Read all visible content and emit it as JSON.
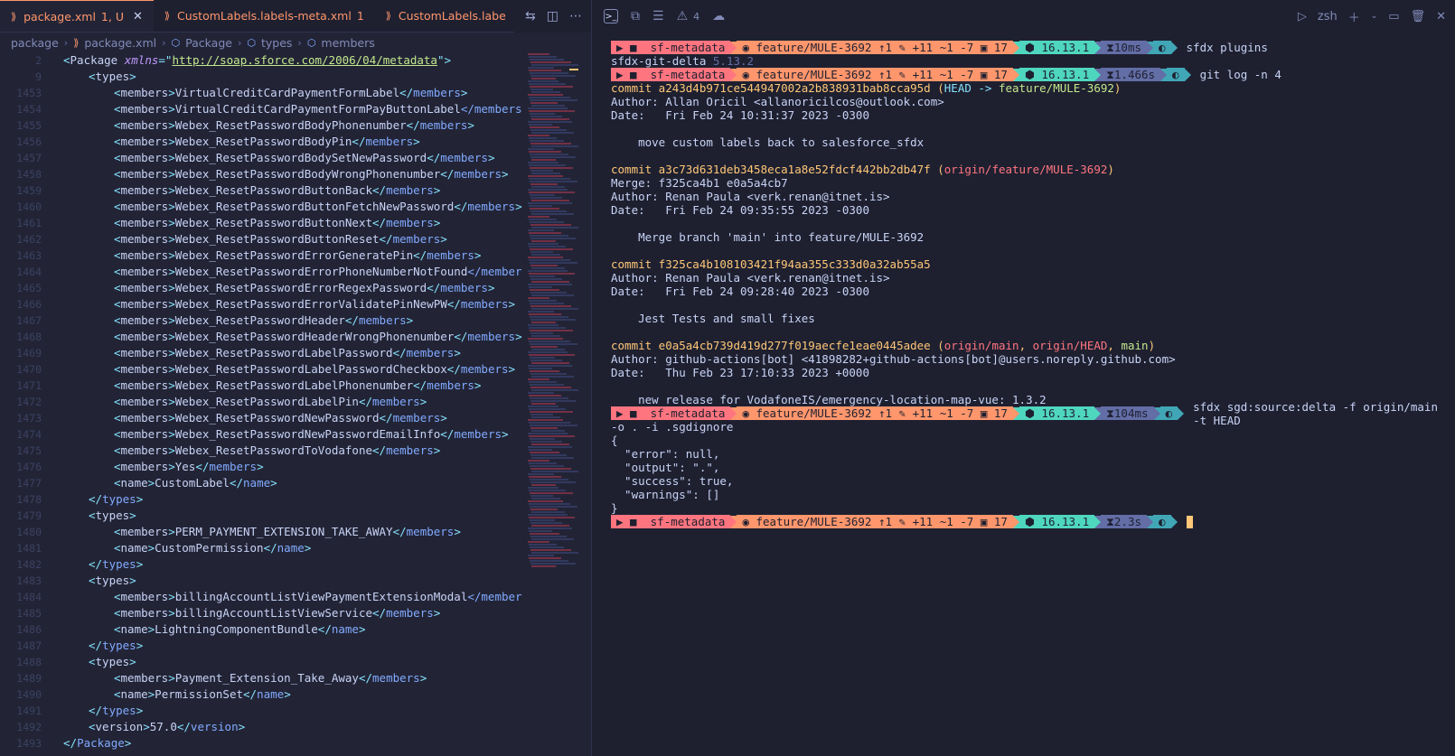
{
  "editor": {
    "tabs": [
      {
        "label": "package.xml",
        "status": "1, U",
        "active": true
      },
      {
        "label": "CustomLabels.labels-meta.xml",
        "status": "1",
        "active": false
      },
      {
        "label": "CustomLabels.labe",
        "status": "",
        "active": false
      }
    ],
    "breadcrumb": [
      "package",
      "package.xml",
      "Package",
      "types",
      "members"
    ],
    "lines": [
      {
        "n": "2",
        "indent": 0,
        "kind": "package-open",
        "text": "Package",
        "attr": "xmlns",
        "url": "http://soap.sforce.com/2006/04/metadata"
      },
      {
        "n": "9",
        "indent": 1,
        "kind": "open",
        "tag": "types"
      },
      {
        "n": "1453",
        "indent": 2,
        "kind": "el",
        "tag": "members",
        "value": "VirtualCreditCardPaymentFormLabel"
      },
      {
        "n": "1454",
        "indent": 2,
        "kind": "el",
        "tag": "members",
        "value": "VirtualCreditCardPaymentFormPayButtonLabel",
        "closeTrunc": "</members"
      },
      {
        "n": "1455",
        "indent": 2,
        "kind": "el",
        "tag": "members",
        "value": "Webex_ResetPasswordBodyPhonenumber"
      },
      {
        "n": "1456",
        "indent": 2,
        "kind": "el",
        "tag": "members",
        "value": "Webex_ResetPasswordBodyPin"
      },
      {
        "n": "1457",
        "indent": 2,
        "kind": "el",
        "tag": "members",
        "value": "Webex_ResetPasswordBodySetNewPassword"
      },
      {
        "n": "1458",
        "indent": 2,
        "kind": "el",
        "tag": "members",
        "value": "Webex_ResetPasswordBodyWrongPhonenumber"
      },
      {
        "n": "1459",
        "indent": 2,
        "kind": "el",
        "tag": "members",
        "value": "Webex_ResetPasswordButtonBack"
      },
      {
        "n": "1460",
        "indent": 2,
        "kind": "el",
        "tag": "members",
        "value": "Webex_ResetPasswordButtonFetchNewPassword"
      },
      {
        "n": "1461",
        "indent": 2,
        "kind": "el",
        "tag": "members",
        "value": "Webex_ResetPasswordButtonNext"
      },
      {
        "n": "1462",
        "indent": 2,
        "kind": "el",
        "tag": "members",
        "value": "Webex_ResetPasswordButtonReset"
      },
      {
        "n": "1463",
        "indent": 2,
        "kind": "el",
        "tag": "members",
        "value": "Webex_ResetPasswordErrorGeneratePin"
      },
      {
        "n": "1464",
        "indent": 2,
        "kind": "el",
        "tag": "members",
        "value": "Webex_ResetPasswordErrorPhoneNumberNotFound",
        "closeTrunc": "</member"
      },
      {
        "n": "1465",
        "indent": 2,
        "kind": "el",
        "tag": "members",
        "value": "Webex_ResetPasswordErrorRegexPassword"
      },
      {
        "n": "1466",
        "indent": 2,
        "kind": "el",
        "tag": "members",
        "value": "Webex_ResetPasswordErrorValidatePinNewPW"
      },
      {
        "n": "1467",
        "indent": 2,
        "kind": "el",
        "tag": "members",
        "value": "Webex_ResetPasswordHeader"
      },
      {
        "n": "1468",
        "indent": 2,
        "kind": "el",
        "tag": "members",
        "value": "Webex_ResetPasswordHeaderWrongPhonenumber"
      },
      {
        "n": "1469",
        "indent": 2,
        "kind": "el",
        "tag": "members",
        "value": "Webex_ResetPasswordLabelPassword"
      },
      {
        "n": "1470",
        "indent": 2,
        "kind": "el",
        "tag": "members",
        "value": "Webex_ResetPasswordLabelPasswordCheckbox"
      },
      {
        "n": "1471",
        "indent": 2,
        "kind": "el",
        "tag": "members",
        "value": "Webex_ResetPasswordLabelPhonenumber"
      },
      {
        "n": "1472",
        "indent": 2,
        "kind": "el",
        "tag": "members",
        "value": "Webex_ResetPasswordLabelPin"
      },
      {
        "n": "1473",
        "indent": 2,
        "kind": "el",
        "tag": "members",
        "value": "Webex_ResetPasswordNewPassword"
      },
      {
        "n": "1474",
        "indent": 2,
        "kind": "el",
        "tag": "members",
        "value": "Webex_ResetPasswordNewPasswordEmailInfo"
      },
      {
        "n": "1475",
        "indent": 2,
        "kind": "el",
        "tag": "members",
        "value": "Webex_ResetPasswordToVodafone"
      },
      {
        "n": "1476",
        "indent": 2,
        "kind": "el",
        "tag": "members",
        "value": "Yes"
      },
      {
        "n": "1477",
        "indent": 2,
        "kind": "el",
        "tag": "name",
        "value": "CustomLabel"
      },
      {
        "n": "1478",
        "indent": 1,
        "kind": "close",
        "tag": "types"
      },
      {
        "n": "1479",
        "indent": 1,
        "kind": "open",
        "tag": "types"
      },
      {
        "n": "1480",
        "indent": 2,
        "kind": "el",
        "tag": "members",
        "value": "PERM_PAYMENT_EXTENSION_TAKE_AWAY"
      },
      {
        "n": "1481",
        "indent": 2,
        "kind": "el",
        "tag": "name",
        "value": "CustomPermission"
      },
      {
        "n": "1482",
        "indent": 1,
        "kind": "close",
        "tag": "types"
      },
      {
        "n": "1483",
        "indent": 1,
        "kind": "open",
        "tag": "types"
      },
      {
        "n": "1484",
        "indent": 2,
        "kind": "el",
        "tag": "members",
        "value": "billingAccountListViewPaymentExtensionModal",
        "closeTrunc": "</member"
      },
      {
        "n": "1485",
        "indent": 2,
        "kind": "el",
        "tag": "members",
        "value": "billingAccountListViewService"
      },
      {
        "n": "1486",
        "indent": 2,
        "kind": "el",
        "tag": "name",
        "value": "LightningComponentBundle"
      },
      {
        "n": "1487",
        "indent": 1,
        "kind": "close",
        "tag": "types"
      },
      {
        "n": "1488",
        "indent": 1,
        "kind": "open",
        "tag": "types"
      },
      {
        "n": "1489",
        "indent": 2,
        "kind": "el",
        "tag": "members",
        "value": "Payment_Extension_Take_Away"
      },
      {
        "n": "1490",
        "indent": 2,
        "kind": "el",
        "tag": "name",
        "value": "PermissionSet"
      },
      {
        "n": "1491",
        "indent": 1,
        "kind": "close",
        "tag": "types"
      },
      {
        "n": "1492",
        "indent": 1,
        "kind": "el",
        "tag": "version",
        "value": "57.0"
      },
      {
        "n": "1493",
        "indent": 0,
        "kind": "close",
        "tag": "Package"
      }
    ]
  },
  "terminal": {
    "toolbar": {
      "problems_count": "4",
      "shell": "zsh"
    },
    "prompt": {
      "dir": "sf-metadata",
      "branch": "feature/MULE-3692 ↑1",
      "changes": "+11 ~1 -7",
      "stash": "17",
      "node": "16.13.1"
    },
    "blocks": [
      {
        "type": "prompt",
        "time": "10ms",
        "cmd": "sfdx plugins"
      },
      {
        "type": "text",
        "parts": [
          {
            "t": "sfdx-git-delta ",
            "c": ""
          },
          {
            "t": "5.13.2",
            "c": "dim"
          }
        ]
      },
      {
        "type": "prompt",
        "time": "1.466s",
        "cmd": "git log -n 4"
      },
      {
        "type": "text",
        "parts": [
          {
            "t": "commit a243d4b971ce544947002a2b838931bab8cca95d ",
            "c": "commit"
          },
          {
            "t": "(",
            "c": "commit"
          },
          {
            "t": "HEAD -> ",
            "c": "ref-head"
          },
          {
            "t": "feature/MULE-3692",
            "c": "ref-main"
          },
          {
            "t": ")",
            "c": "commit"
          }
        ]
      },
      {
        "type": "text",
        "parts": [
          {
            "t": "Author: Allan Oricil <allanoricilcos@outlook.com>",
            "c": ""
          }
        ]
      },
      {
        "type": "text",
        "parts": [
          {
            "t": "Date:   Fri Feb 24 10:31:37 2023 -0300",
            "c": ""
          }
        ]
      },
      {
        "type": "text",
        "parts": [
          {
            "t": "",
            "c": ""
          }
        ]
      },
      {
        "type": "text",
        "parts": [
          {
            "t": "    move custom labels back to salesforce_sfdx",
            "c": ""
          }
        ]
      },
      {
        "type": "text",
        "parts": [
          {
            "t": "",
            "c": ""
          }
        ]
      },
      {
        "type": "text",
        "parts": [
          {
            "t": "commit a3c73d631deb3458eca1a8e52fdcf442bb2db47f ",
            "c": "commit"
          },
          {
            "t": "(",
            "c": "commit"
          },
          {
            "t": "origin/feature/MULE-3692",
            "c": "ref-origin"
          },
          {
            "t": ")",
            "c": "commit"
          }
        ]
      },
      {
        "type": "text",
        "parts": [
          {
            "t": "Merge: f325ca4b1 e0a5a4cb7",
            "c": ""
          }
        ]
      },
      {
        "type": "text",
        "parts": [
          {
            "t": "Author: Renan Paula <verk.renan@itnet.is>",
            "c": ""
          }
        ]
      },
      {
        "type": "text",
        "parts": [
          {
            "t": "Date:   Fri Feb 24 09:35:55 2023 -0300",
            "c": ""
          }
        ]
      },
      {
        "type": "text",
        "parts": [
          {
            "t": "",
            "c": ""
          }
        ]
      },
      {
        "type": "text",
        "parts": [
          {
            "t": "    Merge branch 'main' into feature/MULE-3692",
            "c": ""
          }
        ]
      },
      {
        "type": "text",
        "parts": [
          {
            "t": "",
            "c": ""
          }
        ]
      },
      {
        "type": "text",
        "parts": [
          {
            "t": "commit f325ca4b108103421f94aa355c333d0a32ab55a5",
            "c": "commit"
          }
        ]
      },
      {
        "type": "text",
        "parts": [
          {
            "t": "Author: Renan Paula <verk.renan@itnet.is>",
            "c": ""
          }
        ]
      },
      {
        "type": "text",
        "parts": [
          {
            "t": "Date:   Fri Feb 24 09:28:40 2023 -0300",
            "c": ""
          }
        ]
      },
      {
        "type": "text",
        "parts": [
          {
            "t": "",
            "c": ""
          }
        ]
      },
      {
        "type": "text",
        "parts": [
          {
            "t": "    Jest Tests and small fixes",
            "c": ""
          }
        ]
      },
      {
        "type": "text",
        "parts": [
          {
            "t": "",
            "c": ""
          }
        ]
      },
      {
        "type": "text",
        "parts": [
          {
            "t": "commit e0a5a4cb739d419d277f019aecfe1eae0445adee ",
            "c": "commit"
          },
          {
            "t": "(",
            "c": "commit"
          },
          {
            "t": "origin/main",
            "c": "ref-origin"
          },
          {
            "t": ", ",
            "c": "commit"
          },
          {
            "t": "origin/HEAD",
            "c": "ref-origin"
          },
          {
            "t": ", ",
            "c": "commit"
          },
          {
            "t": "main",
            "c": "ref-main"
          },
          {
            "t": ")",
            "c": "commit"
          }
        ]
      },
      {
        "type": "text",
        "parts": [
          {
            "t": "Author: github-actions[bot] <41898282+github-actions[bot]@users.noreply.github.com>",
            "c": ""
          }
        ]
      },
      {
        "type": "text",
        "parts": [
          {
            "t": "Date:   Thu Feb 23 17:10:33 2023 +0000",
            "c": ""
          }
        ]
      },
      {
        "type": "text",
        "parts": [
          {
            "t": "",
            "c": ""
          }
        ]
      },
      {
        "type": "text",
        "parts": [
          {
            "t": "    new release for VodafoneIS/emergency-location-map-vue: 1.3.2",
            "c": ""
          }
        ]
      },
      {
        "type": "prompt",
        "time": "104ms",
        "cmd": "sfdx sgd:source:delta -f origin/main -t HEAD"
      },
      {
        "type": "text",
        "parts": [
          {
            "t": "-o . -i .sgdignore",
            "c": ""
          }
        ]
      },
      {
        "type": "text",
        "parts": [
          {
            "t": "{",
            "c": ""
          }
        ]
      },
      {
        "type": "text",
        "parts": [
          {
            "t": "  \"error\": null,",
            "c": ""
          }
        ]
      },
      {
        "type": "text",
        "parts": [
          {
            "t": "  \"output\": \".\",",
            "c": ""
          }
        ]
      },
      {
        "type": "text",
        "parts": [
          {
            "t": "  \"success\": true,",
            "c": ""
          }
        ]
      },
      {
        "type": "text",
        "parts": [
          {
            "t": "  \"warnings\": []",
            "c": ""
          }
        ]
      },
      {
        "type": "text",
        "parts": [
          {
            "t": "}",
            "c": ""
          }
        ]
      },
      {
        "type": "prompt",
        "time": "2.3s",
        "cmd": "",
        "cursor": true
      }
    ]
  }
}
